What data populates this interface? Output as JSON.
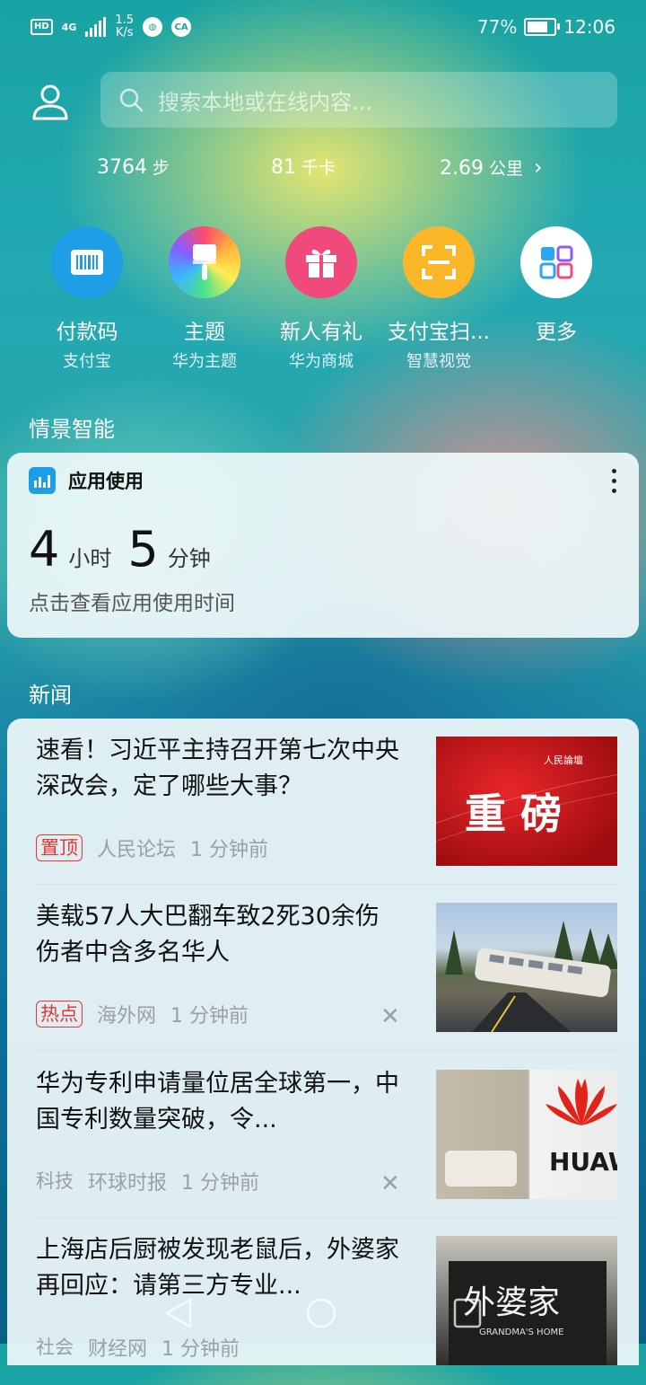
{
  "status_bar": {
    "hd": "HD",
    "network": "4G",
    "speed_value": "1.5",
    "speed_unit": "K/s",
    "battery": "77%",
    "battery_level": 0.77,
    "time": "12:06"
  },
  "search": {
    "placeholder": "搜索本地或在线内容..."
  },
  "stats": [
    {
      "value": "3764",
      "unit": "步"
    },
    {
      "value": "81",
      "unit": "千卡"
    },
    {
      "value": "2.69",
      "unit": "公里"
    }
  ],
  "apps": [
    {
      "name": "付款码",
      "sub": "支付宝",
      "icon": "barcode-icon",
      "color": "#1e9ee6"
    },
    {
      "name": "主题",
      "sub": "华为主题",
      "icon": "brush-icon",
      "color": "rainbow"
    },
    {
      "name": "新人有礼",
      "sub": "华为商城",
      "icon": "gift-icon",
      "color": "#f04a7c"
    },
    {
      "name": "支付宝扫...",
      "sub": "智慧视觉",
      "icon": "scan-icon",
      "color": "#fcb728"
    },
    {
      "name": "更多",
      "sub": "",
      "icon": "grid-icon",
      "color": "#ffffff"
    }
  ],
  "scene_section": {
    "title": "情景智能"
  },
  "usage_card": {
    "title": "应用使用",
    "hours": "4",
    "hours_unit": "小时",
    "minutes": "5",
    "minutes_unit": "分钟",
    "hint": "点击查看应用使用时间"
  },
  "news_section": {
    "title": "新闻"
  },
  "news": [
    {
      "headline": "速看！习近平主持召开第七次中央深改会，定了哪些大事？",
      "tag": "置顶",
      "source": "人民论坛",
      "time": "1 分钟前",
      "thumb_text": "重  磅",
      "thumb_small": "人民論壇"
    },
    {
      "headline": "美载57人大巴翻车致2死30余伤 伤者中含多名华人",
      "tag": "热点",
      "source": "海外网",
      "time": "1 分钟前"
    },
    {
      "headline": "华为专利申请量位居全球第一，中国专利数量突破，令...",
      "tag": "科技",
      "source": "环球时报",
      "time": "1 分钟前",
      "thumb_text": "HUAW"
    },
    {
      "headline": "上海店后厨被发现老鼠后，外婆家再回应：请第三方专业...",
      "tag": "社会",
      "source": "财经网",
      "time": "1 分钟前",
      "thumb_text": "外婆家",
      "thumb_small": "GRANDMA'S HOME"
    }
  ],
  "colors": {
    "accent": "#1e9ee6",
    "hot_tag": "#e33333"
  }
}
